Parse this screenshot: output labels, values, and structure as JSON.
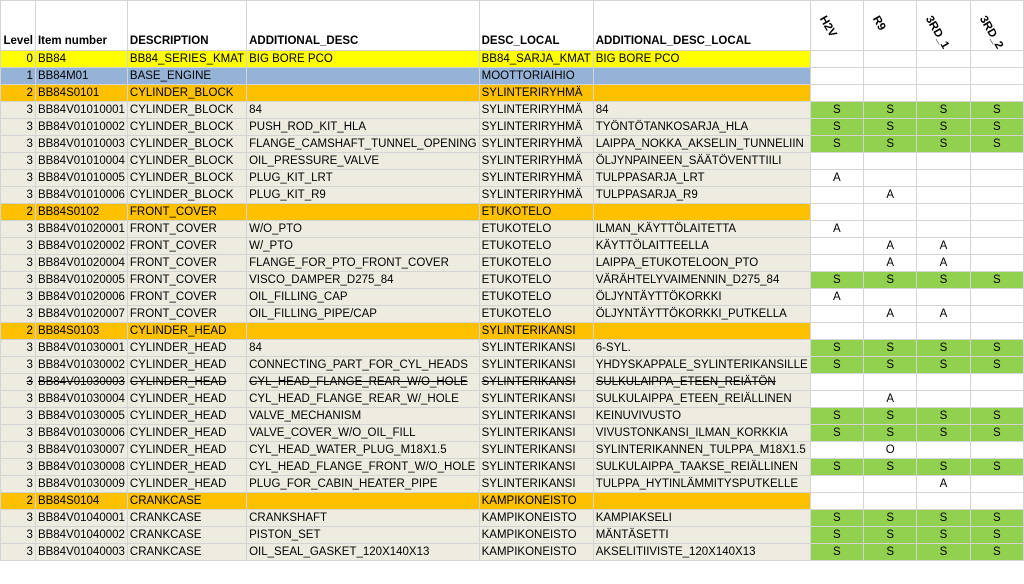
{
  "columns": {
    "level": "Level",
    "item_number": "Item number",
    "description": "DESCRIPTION",
    "additional_desc": "ADDITIONAL_DESC",
    "desc_local": "DESC_LOCAL",
    "additional_desc_local": "ADDITIONAL_DESC_LOCAL",
    "flags": [
      "H2V",
      "R9",
      "3RD_1",
      "3RD_2"
    ]
  },
  "colors": {
    "yellow": "#ffff00",
    "blue": "#95b3d7",
    "orange": "#ffc000",
    "beige": "#eeece1",
    "green": "#92d050"
  },
  "rows": [
    {
      "level": "0",
      "item": "BB84",
      "desc": "BB84_SERIES_KMAT",
      "add": "BIG BORE PCO",
      "local": "BB84_SARJA_KMAT",
      "add_local": "BIG BORE PCO",
      "style": "yellow",
      "flags": [
        "",
        "",
        "",
        ""
      ],
      "green": [
        false,
        false,
        false,
        false
      ]
    },
    {
      "level": "1",
      "item": "BB84M01",
      "desc": "BASE_ENGINE",
      "add": "",
      "local": "MOOTTORIAIHIO",
      "add_local": "",
      "style": "blue",
      "flags": [
        "",
        "",
        "",
        ""
      ],
      "green": [
        false,
        false,
        false,
        false
      ]
    },
    {
      "level": "2",
      "item": "BB84S0101",
      "desc": "CYLINDER_BLOCK",
      "add": "",
      "local": "SYLINTERIRYHMÄ",
      "add_local": "",
      "style": "orange",
      "flags": [
        "",
        "",
        "",
        ""
      ],
      "green": [
        false,
        false,
        false,
        false
      ]
    },
    {
      "level": "3",
      "item": "BB84V01010001",
      "desc": "CYLINDER_BLOCK",
      "add": "84",
      "local": "SYLINTERIRYHMÄ",
      "add_local": "84",
      "style": "beige",
      "flags": [
        "S",
        "S",
        "S",
        "S"
      ],
      "green": [
        true,
        true,
        true,
        true
      ]
    },
    {
      "level": "3",
      "item": "BB84V01010002",
      "desc": "CYLINDER_BLOCK",
      "add": "PUSH_ROD_KIT_HLA",
      "local": "SYLINTERIRYHMÄ",
      "add_local": "TYÖNTÖTANKOSARJA_HLA",
      "style": "beige",
      "flags": [
        "S",
        "S",
        "S",
        "S"
      ],
      "green": [
        true,
        true,
        true,
        true
      ]
    },
    {
      "level": "3",
      "item": "BB84V01010003",
      "desc": "CYLINDER_BLOCK",
      "add": "FLANGE_CAMSHAFT_TUNNEL_OPENING",
      "local": "SYLINTERIRYHMÄ",
      "add_local": "LAIPPA_NOKKA_AKSELIN_TUNNELIIN",
      "style": "beige",
      "flags": [
        "S",
        "S",
        "S",
        "S"
      ],
      "green": [
        true,
        true,
        true,
        true
      ]
    },
    {
      "level": "3",
      "item": "BB84V01010004",
      "desc": "CYLINDER_BLOCK",
      "add": "OIL_PRESSURE_VALVE",
      "local": "SYLINTERIRYHMÄ",
      "add_local": "ÖLJYNPAINEEN_SÄÄTÖVENTTIILI",
      "style": "beige",
      "flags": [
        "",
        "",
        "",
        ""
      ],
      "green": [
        false,
        false,
        false,
        false
      ]
    },
    {
      "level": "3",
      "item": "BB84V01010005",
      "desc": "CYLINDER_BLOCK",
      "add": "PLUG_KIT_LRT",
      "local": "SYLINTERIRYHMÄ",
      "add_local": "TULPPASARJA_LRT",
      "style": "beige",
      "flags": [
        "A",
        "",
        "",
        ""
      ],
      "green": [
        false,
        false,
        false,
        false
      ]
    },
    {
      "level": "3",
      "item": "BB84V01010006",
      "desc": "CYLINDER_BLOCK",
      "add": "PLUG_KIT_R9",
      "local": "SYLINTERIRYHMÄ",
      "add_local": "TULPPASARJA_R9",
      "style": "beige",
      "flags": [
        "",
        "A",
        "",
        ""
      ],
      "green": [
        false,
        false,
        false,
        false
      ]
    },
    {
      "level": "2",
      "item": "BB84S0102",
      "desc": "FRONT_COVER",
      "add": "",
      "local": "ETUKOTELO",
      "add_local": "",
      "style": "orange",
      "flags": [
        "",
        "",
        "",
        ""
      ],
      "green": [
        false,
        false,
        false,
        false
      ]
    },
    {
      "level": "3",
      "item": "BB84V01020001",
      "desc": "FRONT_COVER",
      "add": "W/O_PTO",
      "local": "ETUKOTELO",
      "add_local": "ILMAN_KÄYTTÖLAITETTA",
      "style": "beige",
      "flags": [
        "A",
        "",
        "",
        ""
      ],
      "green": [
        false,
        false,
        false,
        false
      ]
    },
    {
      "level": "3",
      "item": "BB84V01020002",
      "desc": "FRONT_COVER",
      "add": "W/_PTO",
      "local": "ETUKOTELO",
      "add_local": "KÄYTTÖLAITTEELLA",
      "style": "beige",
      "flags": [
        "",
        "A",
        "A",
        ""
      ],
      "green": [
        false,
        false,
        false,
        false
      ]
    },
    {
      "level": "3",
      "item": "BB84V01020004",
      "desc": "FRONT_COVER",
      "add": "FLANGE_FOR_PTO_FRONT_COVER",
      "local": "ETUKOTELO",
      "add_local": "LAIPPA_ETUKOTELOON_PTO",
      "style": "beige",
      "flags": [
        "",
        "A",
        "A",
        ""
      ],
      "green": [
        false,
        false,
        false,
        false
      ]
    },
    {
      "level": "3",
      "item": "BB84V01020005",
      "desc": "FRONT_COVER",
      "add": "VISCO_DAMPER_D275_84",
      "local": "ETUKOTELO",
      "add_local": "VÄRÄHTELYVAIMENNIN_D275_84",
      "style": "beige",
      "flags": [
        "S",
        "S",
        "S",
        "S"
      ],
      "green": [
        true,
        true,
        true,
        true
      ]
    },
    {
      "level": "3",
      "item": "BB84V01020006",
      "desc": "FRONT_COVER",
      "add": "OIL_FILLING_CAP",
      "local": "ETUKOTELO",
      "add_local": "ÖLJYNTÄYTTÖKORKKI",
      "style": "beige",
      "flags": [
        "A",
        "",
        "",
        ""
      ],
      "green": [
        false,
        false,
        false,
        false
      ]
    },
    {
      "level": "3",
      "item": "BB84V01020007",
      "desc": "FRONT_COVER",
      "add": "OIL_FILLING_PIPE/CAP",
      "local": "ETUKOTELO",
      "add_local": "ÖLJYNTÄYTTÖKORKKI_PUTKELLA",
      "style": "beige",
      "flags": [
        "",
        "A",
        "A",
        ""
      ],
      "green": [
        false,
        false,
        false,
        false
      ]
    },
    {
      "level": "2",
      "item": "BB84S0103",
      "desc": "CYLINDER_HEAD",
      "add": "",
      "local": "SYLINTERIKANSI",
      "add_local": "",
      "style": "orange",
      "flags": [
        "",
        "",
        "",
        ""
      ],
      "green": [
        false,
        false,
        false,
        false
      ]
    },
    {
      "level": "3",
      "item": "BB84V01030001",
      "desc": "CYLINDER_HEAD",
      "add": "84",
      "local": "SYLINTERIKANSI",
      "add_local": "6-SYL.",
      "style": "beige",
      "flags": [
        "S",
        "S",
        "S",
        "S"
      ],
      "green": [
        true,
        true,
        true,
        true
      ]
    },
    {
      "level": "3",
      "item": "BB84V01030002",
      "desc": "CYLINDER_HEAD",
      "add": "CONNECTING_PART_FOR_CYL_HEADS",
      "local": "SYLINTERIKANSI",
      "add_local": "YHDYSKAPPALE_SYLINTERIKANSILLE",
      "style": "beige",
      "flags": [
        "S",
        "S",
        "S",
        "S"
      ],
      "green": [
        true,
        true,
        true,
        true
      ]
    },
    {
      "level": "3",
      "item": "BB84V01030003",
      "desc": "CYLINDER_HEAD",
      "add": "CYL_HEAD_FLANGE_REAR_W/O_HOLE",
      "local": "SYLINTERIKANSI",
      "add_local": "SULKULAIPPA_ETEEN_REIÄTÖN",
      "style": "beige",
      "strike": true,
      "flags": [
        "",
        "",
        "",
        ""
      ],
      "green": [
        false,
        false,
        false,
        false
      ]
    },
    {
      "level": "3",
      "item": "BB84V01030004",
      "desc": "CYLINDER_HEAD",
      "add": "CYL_HEAD_FLANGE_REAR_W/_HOLE",
      "local": "SYLINTERIKANSI",
      "add_local": "SULKULAIPPA_ETEEN_REIÄLLINEN",
      "style": "beige",
      "flags": [
        "",
        "A",
        "",
        ""
      ],
      "green": [
        false,
        false,
        false,
        false
      ]
    },
    {
      "level": "3",
      "item": "BB84V01030005",
      "desc": "CYLINDER_HEAD",
      "add": "VALVE_MECHANISM",
      "local": "SYLINTERIKANSI",
      "add_local": "KEINUVIVUSTO",
      "style": "beige",
      "flags": [
        "S",
        "S",
        "S",
        "S"
      ],
      "green": [
        true,
        true,
        true,
        true
      ]
    },
    {
      "level": "3",
      "item": "BB84V01030006",
      "desc": "CYLINDER_HEAD",
      "add": "VALVE_COVER_W/O_OIL_FILL",
      "local": "SYLINTERIKANSI",
      "add_local": "VIVUSTONKANSI_ILMAN_KORKKIA",
      "style": "beige",
      "flags": [
        "S",
        "S",
        "S",
        "S"
      ],
      "green": [
        true,
        true,
        true,
        true
      ]
    },
    {
      "level": "3",
      "item": "BB84V01030007",
      "desc": "CYLINDER_HEAD",
      "add": "CYL_HEAD_WATER_PLUG_M18X1.5",
      "local": "SYLINTERIKANSI",
      "add_local": "SYLINTERIKANNEN_TULPPA_M18X1.5",
      "style": "beige",
      "flags": [
        "",
        "O",
        "",
        ""
      ],
      "green": [
        false,
        false,
        false,
        false
      ]
    },
    {
      "level": "3",
      "item": "BB84V01030008",
      "desc": "CYLINDER_HEAD",
      "add": "CYL_HEAD_FLANGE_FRONT_W/O_HOLE",
      "local": "SYLINTERIKANSI",
      "add_local": "SULKULAIPPA_TAAKSE_REIÄLLINEN",
      "style": "beige",
      "flags": [
        "S",
        "S",
        "S",
        "S"
      ],
      "green": [
        true,
        true,
        true,
        true
      ]
    },
    {
      "level": "3",
      "item": "BB84V01030009",
      "desc": "CYLINDER_HEAD",
      "add": "PLUG_FOR_CABIN_HEATER_PIPE",
      "local": "SYLINTERIKANSI",
      "add_local": "TULPPA_HYTINLÄMMITYSPUTKELLE",
      "style": "beige",
      "flags": [
        "",
        "",
        "A",
        ""
      ],
      "green": [
        false,
        false,
        false,
        false
      ]
    },
    {
      "level": "2",
      "item": "BB84S0104",
      "desc": "CRANKCASE",
      "add": "",
      "local": "KAMPIKONEISTO",
      "add_local": "",
      "style": "orange",
      "flags": [
        "",
        "",
        "",
        ""
      ],
      "green": [
        false,
        false,
        false,
        false
      ]
    },
    {
      "level": "3",
      "item": "BB84V01040001",
      "desc": "CRANKCASE",
      "add": "CRANKSHAFT",
      "local": "KAMPIKONEISTO",
      "add_local": "KAMPIAKSELI",
      "style": "beige",
      "flags": [
        "S",
        "S",
        "S",
        "S"
      ],
      "green": [
        true,
        true,
        true,
        true
      ]
    },
    {
      "level": "3",
      "item": "BB84V01040002",
      "desc": "CRANKCASE",
      "add": "PISTON_SET",
      "local": "KAMPIKONEISTO",
      "add_local": "MÄNTÄSETTI",
      "style": "beige",
      "flags": [
        "S",
        "S",
        "S",
        "S"
      ],
      "green": [
        true,
        true,
        true,
        true
      ]
    },
    {
      "level": "3",
      "item": "BB84V01040003",
      "desc": "CRANKCASE",
      "add": "OIL_SEAL_GASKET_120X140X13",
      "local": "KAMPIKONEISTO",
      "add_local": "AKSELITIIVISTE_120X140X13",
      "style": "beige",
      "flags": [
        "S",
        "S",
        "S",
        "S"
      ],
      "green": [
        true,
        true,
        true,
        true
      ]
    }
  ]
}
